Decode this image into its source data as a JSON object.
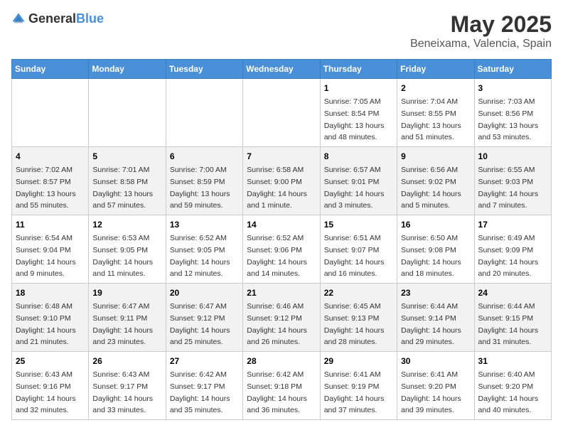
{
  "header": {
    "logo_general": "General",
    "logo_blue": "Blue",
    "title": "May 2025",
    "subtitle": "Beneixama, Valencia, Spain"
  },
  "weekdays": [
    "Sunday",
    "Monday",
    "Tuesday",
    "Wednesday",
    "Thursday",
    "Friday",
    "Saturday"
  ],
  "weeks": [
    [
      {
        "day": "",
        "sunrise": "",
        "sunset": "",
        "daylight": ""
      },
      {
        "day": "",
        "sunrise": "",
        "sunset": "",
        "daylight": ""
      },
      {
        "day": "",
        "sunrise": "",
        "sunset": "",
        "daylight": ""
      },
      {
        "day": "",
        "sunrise": "",
        "sunset": "",
        "daylight": ""
      },
      {
        "day": "1",
        "sunrise": "Sunrise: 7:05 AM",
        "sunset": "Sunset: 8:54 PM",
        "daylight": "Daylight: 13 hours and 48 minutes."
      },
      {
        "day": "2",
        "sunrise": "Sunrise: 7:04 AM",
        "sunset": "Sunset: 8:55 PM",
        "daylight": "Daylight: 13 hours and 51 minutes."
      },
      {
        "day": "3",
        "sunrise": "Sunrise: 7:03 AM",
        "sunset": "Sunset: 8:56 PM",
        "daylight": "Daylight: 13 hours and 53 minutes."
      }
    ],
    [
      {
        "day": "4",
        "sunrise": "Sunrise: 7:02 AM",
        "sunset": "Sunset: 8:57 PM",
        "daylight": "Daylight: 13 hours and 55 minutes."
      },
      {
        "day": "5",
        "sunrise": "Sunrise: 7:01 AM",
        "sunset": "Sunset: 8:58 PM",
        "daylight": "Daylight: 13 hours and 57 minutes."
      },
      {
        "day": "6",
        "sunrise": "Sunrise: 7:00 AM",
        "sunset": "Sunset: 8:59 PM",
        "daylight": "Daylight: 13 hours and 59 minutes."
      },
      {
        "day": "7",
        "sunrise": "Sunrise: 6:58 AM",
        "sunset": "Sunset: 9:00 PM",
        "daylight": "Daylight: 14 hours and 1 minute."
      },
      {
        "day": "8",
        "sunrise": "Sunrise: 6:57 AM",
        "sunset": "Sunset: 9:01 PM",
        "daylight": "Daylight: 14 hours and 3 minutes."
      },
      {
        "day": "9",
        "sunrise": "Sunrise: 6:56 AM",
        "sunset": "Sunset: 9:02 PM",
        "daylight": "Daylight: 14 hours and 5 minutes."
      },
      {
        "day": "10",
        "sunrise": "Sunrise: 6:55 AM",
        "sunset": "Sunset: 9:03 PM",
        "daylight": "Daylight: 14 hours and 7 minutes."
      }
    ],
    [
      {
        "day": "11",
        "sunrise": "Sunrise: 6:54 AM",
        "sunset": "Sunset: 9:04 PM",
        "daylight": "Daylight: 14 hours and 9 minutes."
      },
      {
        "day": "12",
        "sunrise": "Sunrise: 6:53 AM",
        "sunset": "Sunset: 9:05 PM",
        "daylight": "Daylight: 14 hours and 11 minutes."
      },
      {
        "day": "13",
        "sunrise": "Sunrise: 6:52 AM",
        "sunset": "Sunset: 9:05 PM",
        "daylight": "Daylight: 14 hours and 12 minutes."
      },
      {
        "day": "14",
        "sunrise": "Sunrise: 6:52 AM",
        "sunset": "Sunset: 9:06 PM",
        "daylight": "Daylight: 14 hours and 14 minutes."
      },
      {
        "day": "15",
        "sunrise": "Sunrise: 6:51 AM",
        "sunset": "Sunset: 9:07 PM",
        "daylight": "Daylight: 14 hours and 16 minutes."
      },
      {
        "day": "16",
        "sunrise": "Sunrise: 6:50 AM",
        "sunset": "Sunset: 9:08 PM",
        "daylight": "Daylight: 14 hours and 18 minutes."
      },
      {
        "day": "17",
        "sunrise": "Sunrise: 6:49 AM",
        "sunset": "Sunset: 9:09 PM",
        "daylight": "Daylight: 14 hours and 20 minutes."
      }
    ],
    [
      {
        "day": "18",
        "sunrise": "Sunrise: 6:48 AM",
        "sunset": "Sunset: 9:10 PM",
        "daylight": "Daylight: 14 hours and 21 minutes."
      },
      {
        "day": "19",
        "sunrise": "Sunrise: 6:47 AM",
        "sunset": "Sunset: 9:11 PM",
        "daylight": "Daylight: 14 hours and 23 minutes."
      },
      {
        "day": "20",
        "sunrise": "Sunrise: 6:47 AM",
        "sunset": "Sunset: 9:12 PM",
        "daylight": "Daylight: 14 hours and 25 minutes."
      },
      {
        "day": "21",
        "sunrise": "Sunrise: 6:46 AM",
        "sunset": "Sunset: 9:12 PM",
        "daylight": "Daylight: 14 hours and 26 minutes."
      },
      {
        "day": "22",
        "sunrise": "Sunrise: 6:45 AM",
        "sunset": "Sunset: 9:13 PM",
        "daylight": "Daylight: 14 hours and 28 minutes."
      },
      {
        "day": "23",
        "sunrise": "Sunrise: 6:44 AM",
        "sunset": "Sunset: 9:14 PM",
        "daylight": "Daylight: 14 hours and 29 minutes."
      },
      {
        "day": "24",
        "sunrise": "Sunrise: 6:44 AM",
        "sunset": "Sunset: 9:15 PM",
        "daylight": "Daylight: 14 hours and 31 minutes."
      }
    ],
    [
      {
        "day": "25",
        "sunrise": "Sunrise: 6:43 AM",
        "sunset": "Sunset: 9:16 PM",
        "daylight": "Daylight: 14 hours and 32 minutes."
      },
      {
        "day": "26",
        "sunrise": "Sunrise: 6:43 AM",
        "sunset": "Sunset: 9:17 PM",
        "daylight": "Daylight: 14 hours and 33 minutes."
      },
      {
        "day": "27",
        "sunrise": "Sunrise: 6:42 AM",
        "sunset": "Sunset: 9:17 PM",
        "daylight": "Daylight: 14 hours and 35 minutes."
      },
      {
        "day": "28",
        "sunrise": "Sunrise: 6:42 AM",
        "sunset": "Sunset: 9:18 PM",
        "daylight": "Daylight: 14 hours and 36 minutes."
      },
      {
        "day": "29",
        "sunrise": "Sunrise: 6:41 AM",
        "sunset": "Sunset: 9:19 PM",
        "daylight": "Daylight: 14 hours and 37 minutes."
      },
      {
        "day": "30",
        "sunrise": "Sunrise: 6:41 AM",
        "sunset": "Sunset: 9:20 PM",
        "daylight": "Daylight: 14 hours and 39 minutes."
      },
      {
        "day": "31",
        "sunrise": "Sunrise: 6:40 AM",
        "sunset": "Sunset: 9:20 PM",
        "daylight": "Daylight: 14 hours and 40 minutes."
      }
    ]
  ]
}
